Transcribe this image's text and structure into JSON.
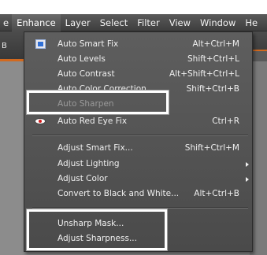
{
  "menubar": {
    "items": [
      {
        "label": "e"
      },
      {
        "label": "Enhance"
      },
      {
        "label": "Layer"
      },
      {
        "label": "Select"
      },
      {
        "label": "Filter"
      },
      {
        "label": "View"
      },
      {
        "label": "Window"
      },
      {
        "label": "He"
      }
    ]
  },
  "toolbar": {
    "partial_text": "B"
  },
  "enhance_menu": {
    "items": [
      {
        "label": "Auto Smart Fix",
        "shortcut": "Alt+Ctrl+M",
        "icon": "smart-fix-icon"
      },
      {
        "label": "Auto Levels",
        "shortcut": "Shift+Ctrl+L"
      },
      {
        "label": "Auto Contrast",
        "shortcut": "Alt+Shift+Ctrl+L"
      },
      {
        "label": "Auto Color Correction",
        "shortcut": "Shift+Ctrl+B"
      },
      {
        "label": "Auto Sharpen",
        "shortcut": "",
        "disabled": true
      },
      {
        "label": "Auto Red Eye Fix",
        "shortcut": "Ctrl+R",
        "icon": "red-eye-icon"
      },
      {
        "label": "Adjust Smart Fix...",
        "shortcut": "Shift+Ctrl+M"
      },
      {
        "label": "Adjust Lighting",
        "shortcut": "",
        "submenu": true
      },
      {
        "label": "Adjust Color",
        "shortcut": "",
        "submenu": true
      },
      {
        "label": "Convert to Black and White...",
        "shortcut": "Alt+Ctrl+B"
      },
      {
        "label": "Unsharp Mask...",
        "shortcut": ""
      },
      {
        "label": "Adjust Sharpness...",
        "shortcut": ""
      }
    ]
  },
  "colors": {
    "menu_background": "#555555",
    "menu_text": "#f0f0f0",
    "highlight_outline": "#ffffff",
    "toolbar_accent": "#d2691e"
  }
}
